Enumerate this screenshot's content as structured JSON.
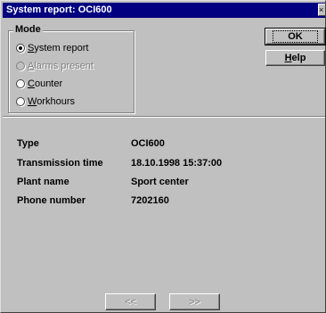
{
  "window": {
    "title": "System report: OCI600",
    "close_glyph": "×"
  },
  "mode": {
    "group_label": "Mode",
    "options": [
      {
        "prefix": "",
        "accel": "S",
        "rest": "ystem report",
        "checked": true,
        "disabled": false
      },
      {
        "prefix": "",
        "accel": "A",
        "rest": "larms present",
        "checked": false,
        "disabled": true
      },
      {
        "prefix": "",
        "accel": "C",
        "rest": "ounter",
        "checked": false,
        "disabled": false
      },
      {
        "prefix": "",
        "accel": "W",
        "rest": "orkhours",
        "checked": false,
        "disabled": false
      }
    ]
  },
  "buttons": {
    "ok": "OK",
    "help_accel": "H",
    "help_rest": "elp",
    "prev": "<<",
    "next": ">>"
  },
  "info": [
    {
      "label": "Type",
      "value": "OCI600"
    },
    {
      "label": "Transmission time",
      "value": "18.10.1998 15:37:00"
    },
    {
      "label": "Plant name",
      "value": "Sport center"
    },
    {
      "label": "Phone number",
      "value": "7202160"
    }
  ]
}
